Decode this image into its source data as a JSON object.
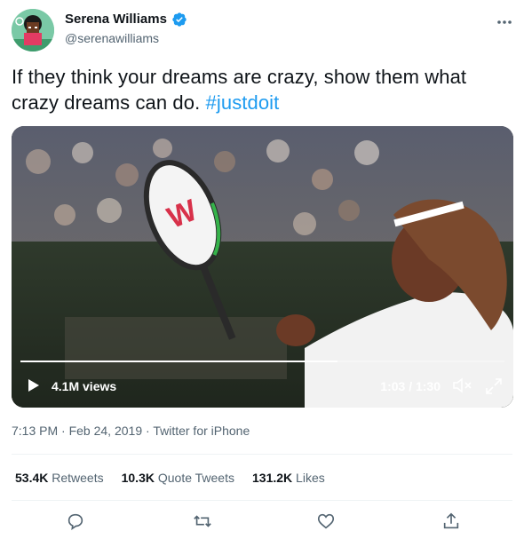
{
  "user": {
    "display_name": "Serena Williams",
    "handle": "@serenawilliams",
    "verified": true
  },
  "tweet": {
    "text": "If they think your dreams are crazy, show them what crazy dreams can do.",
    "hashtag": "#justdoit"
  },
  "video": {
    "views": "4.1M views",
    "time": "1:03 / 1:30",
    "progress_fraction": 0.655
  },
  "meta": {
    "time": "7:13 PM",
    "separator": "·",
    "date": "Feb 24, 2019",
    "source": "Twitter for iPhone"
  },
  "stats": {
    "retweets_count": "53.4K",
    "retweets_label": "Retweets",
    "quotes_count": "10.3K",
    "quotes_label": "Quote Tweets",
    "likes_count": "131.2K",
    "likes_label": "Likes"
  },
  "icons": {
    "verified": "verified-badge-icon",
    "more": "more-icon",
    "play": "play-icon",
    "mute": "mute-icon",
    "expand": "expand-icon",
    "reply": "reply-icon",
    "retweet": "retweet-icon",
    "like": "heart-icon",
    "share": "share-icon"
  },
  "colors": {
    "accent": "#1d9bf0",
    "text": "#0f1419",
    "secondary": "#536471"
  }
}
